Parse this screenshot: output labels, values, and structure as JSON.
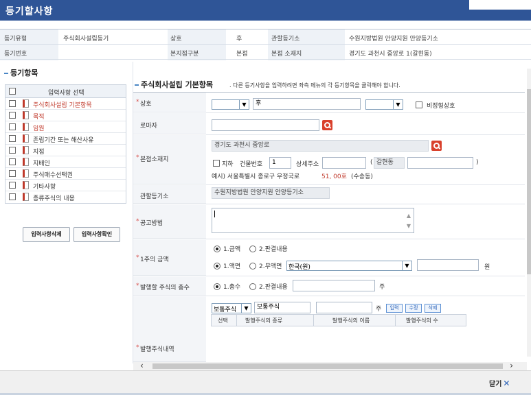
{
  "window": {
    "title": "등기할사항"
  },
  "info": {
    "row1": [
      {
        "label": "등기유형",
        "value": "주식회사설립등기"
      },
      {
        "label": "상호",
        "value": "후"
      },
      {
        "label": "관할등기소",
        "value": "수원지방법원 안양지원 안양등기소"
      }
    ],
    "row2": [
      {
        "label": "등기번호",
        "value": ""
      },
      {
        "label": "본지점구분",
        "value": "본점"
      },
      {
        "label": "본점 소재지",
        "value": "경기도 과천시 중앙로 1(갈현동)"
      }
    ]
  },
  "left": {
    "title": "등기항목",
    "header": "입력사항 선택",
    "items": [
      {
        "label": "주식회사설립 기본항목",
        "active": true
      },
      {
        "label": "목적",
        "active": true
      },
      {
        "label": "임원",
        "active": true
      },
      {
        "label": "존립기간 또는 해산사유",
        "active": false
      },
      {
        "label": "지점",
        "active": false
      },
      {
        "label": "지배인",
        "active": false
      },
      {
        "label": "주식매수선택권",
        "active": false
      },
      {
        "label": "기타사항",
        "active": false
      },
      {
        "label": "종류주식의 내용",
        "active": false
      }
    ],
    "delete_btn": "입력사항삭제",
    "confirm_btn": "입력사항확인"
  },
  "main": {
    "title": "주식회사설립 기본항목",
    "hint": ". 다른 등기사항을 입력하려면 좌측 메뉴의 각 등기항목을 클릭해야 합니다.",
    "fields": {
      "name": {
        "label": "상호",
        "value": "후",
        "nonstandard": "비정형상호"
      },
      "roman": {
        "label": "로마자"
      },
      "address": {
        "label": "본점소재지",
        "road": "경기도 과천시 중앙로",
        "basement": "지하",
        "building_no_label": "건물번호",
        "building_no": "1",
        "detail_label": "상세주소",
        "dong_prefix": "(",
        "dong": "갈현동",
        "dong_suffix": ")",
        "example_prefix": "예시) 서울특별시 종로구 우정국로",
        "example_num": "51, 00호",
        "example_suffix": "(수송동)"
      },
      "court": {
        "label": "관할등기소",
        "value": "수원지방법원 안양지원 안양등기소"
      },
      "notice": {
        "label": "공고방법"
      },
      "share_amount": {
        "label": "1주의 금액",
        "opt1": "1.금액",
        "opt2": "2.판결내용",
        "opt3": "1.액면",
        "opt4": "2.무액면",
        "currency": "한국(원)",
        "unit": "원"
      },
      "total_shares": {
        "label": "발행할 주식의 총수",
        "opt1": "1.총수",
        "opt2": "2.판결내용",
        "unit": "주"
      },
      "issued": {
        "label": "발행주식내역",
        "type_select": "보통주식",
        "type_name": "보통주식",
        "unit": "주",
        "add": "입력",
        "edit": "수정",
        "del": "삭제",
        "columns": [
          "선택",
          "발행주식의 종류",
          "발행주식의 이름",
          "발행주식의 수"
        ]
      }
    }
  },
  "footer": {
    "close": "닫기"
  }
}
